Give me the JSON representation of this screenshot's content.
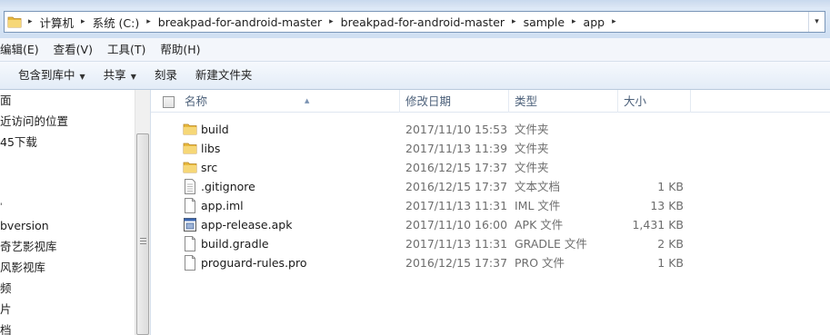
{
  "address": {
    "segments": [
      "计算机",
      "系统 (C:)",
      "breakpad-for-android-master",
      "breakpad-for-android-master",
      "sample",
      "app"
    ],
    "separator": "▸",
    "dropdown": "▾"
  },
  "menu": {
    "items": [
      "编辑(E)",
      "查看(V)",
      "工具(T)",
      "帮助(H)"
    ]
  },
  "commands": {
    "items": [
      {
        "label": "包含到库中",
        "has_dropdown": true
      },
      {
        "label": "共享",
        "has_dropdown": true
      },
      {
        "label": "刻录",
        "has_dropdown": false
      },
      {
        "label": "新建文件夹",
        "has_dropdown": false
      }
    ],
    "arrow": "▼"
  },
  "nav": {
    "items": [
      "面",
      "近访问的位置",
      "45下载",
      "",
      "",
      "bversion",
      "奇艺影视库",
      "风影视库",
      "频",
      "片",
      "档"
    ]
  },
  "columns": {
    "name": "名称",
    "date": "修改日期",
    "type": "类型",
    "size": "大小",
    "sort_indicator": "▲"
  },
  "files": [
    {
      "name": "build",
      "date": "2017/11/10 15:53",
      "type": "文件夹",
      "size": "",
      "icon": "folder-icon"
    },
    {
      "name": "libs",
      "date": "2017/11/13 11:39",
      "type": "文件夹",
      "size": "",
      "icon": "folder-icon"
    },
    {
      "name": "src",
      "date": "2016/12/15 17:37",
      "type": "文件夹",
      "size": "",
      "icon": "folder-icon"
    },
    {
      "name": ".gitignore",
      "date": "2016/12/15 17:37",
      "type": "文本文档",
      "size": "1 KB",
      "icon": "text-document-icon"
    },
    {
      "name": "app.iml",
      "date": "2017/11/13 11:31",
      "type": "IML 文件",
      "size": "13 KB",
      "icon": "blank-file-icon"
    },
    {
      "name": "app-release.apk",
      "date": "2017/11/10 16:00",
      "type": "APK 文件",
      "size": "1,431 KB",
      "icon": "apk-file-icon"
    },
    {
      "name": "build.gradle",
      "date": "2017/11/13 11:31",
      "type": "GRADLE 文件",
      "size": "2 KB",
      "icon": "blank-file-icon"
    },
    {
      "name": "proguard-rules.pro",
      "date": "2016/12/15 17:37",
      "type": "PRO 文件",
      "size": "1 KB",
      "icon": "blank-file-icon"
    }
  ],
  "colors": {
    "folder": "#e8b93c",
    "header_text": "#4c607a",
    "secondary_text": "#6d6d6d"
  }
}
